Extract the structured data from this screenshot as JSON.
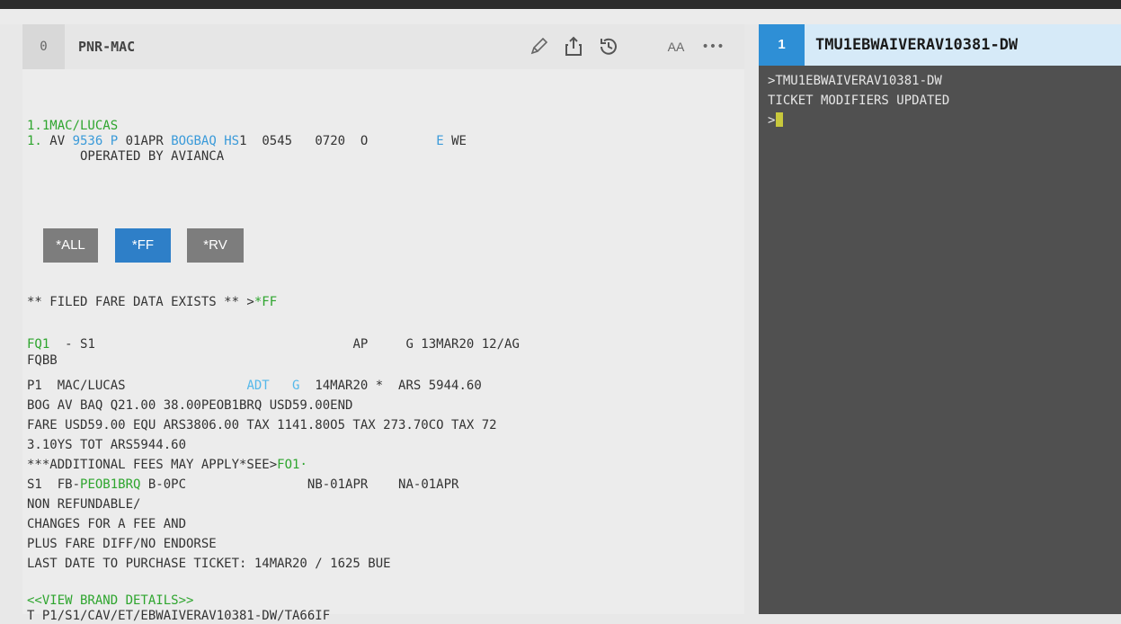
{
  "left_window": {
    "number": "0",
    "title": "PNR-MAC",
    "icons": [
      "pencil-icon",
      "share-icon",
      "history-icon",
      "font-size-icon",
      "more-icon"
    ],
    "font_size_label": "AA",
    "more_label": "•••"
  },
  "quick_buttons": [
    "*ALL",
    "*FF",
    "*RV"
  ],
  "pnr": {
    "name_line": "1.1MAC/LUCAS",
    "seg_prefix": "1.",
    "seg_carrier": " AV ",
    "seg_flight": "9536",
    "seg_space1": " ",
    "seg_class": "P",
    "seg_date": " 01APR ",
    "seg_route": "BOGBAQ",
    "seg_space2": " ",
    "seg_status": "HS",
    "seg_rest": "1  0545   0720  O         ",
    "seg_e": "E",
    "seg_day": " WE",
    "operated_by": "       OPERATED BY AVIANCA"
  },
  "fare": {
    "filed_text": "** FILED FARE DATA EXISTS ** >",
    "filed_link": "*FF",
    "fq_label": "FQ1",
    "fq_rest": "  - S1                                  AP     G 13MAR20 12/AG",
    "fqbb": "FQBB",
    "p1_left": "P1  MAC/LUCAS                ",
    "p1_adt": "ADT",
    "p1_mid": "   ",
    "p1_g": "G",
    "p1_right": "  14MAR20 *  ARS 5944.60",
    "calc": "BOG AV BAQ Q21.00 38.00PEOB1BRQ USD59.00END",
    "fare_line1": "FARE USD59.00 EQU ARS3806.00 TAX 1141.80O5 TAX 273.70CO TAX 72",
    "fare_line2": "3.10YS TOT ARS5944.60",
    "addl_text": "***ADDITIONAL FEES MAY APPLY*SEE>",
    "addl_link": "FO1·",
    "s1_left": "S1  FB-",
    "s1_fb": "PEOB1BRQ",
    "s1_right": " B-0PC                NB-01APR    NA-01APR",
    "nonref": "NON REFUNDABLE/",
    "changes": "CHANGES FOR A FEE AND",
    "plus": "PLUS FARE DIFF/NO ENDORSE",
    "lastdate": "LAST DATE TO PURCHASE TICKET: 14MAR20 / 1625 BUE",
    "brand": "<<VIEW BRAND DETAILS>>",
    "t_line": "T P1/S1/CAV/ET/EBWAIVERAV10381-DW/TA66IF"
  },
  "right_window": {
    "number": "1",
    "title": "TMU1EBWAIVERAV10381-DW",
    "lines": [
      ">TMU1EBWAIVERAV10381-DW",
      "TICKET MODIFIERS UPDATED"
    ],
    "prompt": ">"
  },
  "colors": {
    "green": "#2ea52e",
    "blue": "#3a9ad9",
    "button_gray": "#7d7d7d",
    "button_blue": "#2e7fc8",
    "right_bg": "#505050",
    "right_header": "#d6eaf8"
  }
}
